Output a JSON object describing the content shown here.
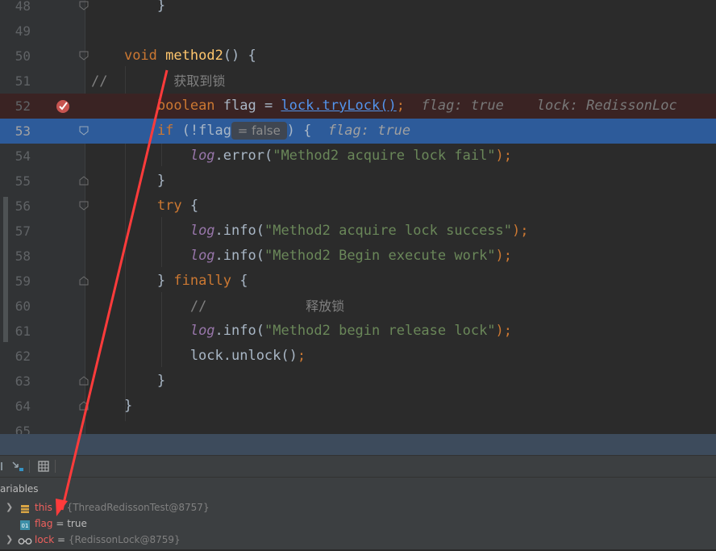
{
  "editor": {
    "lines": [
      {
        "num": "48",
        "segments": [
          {
            "t": "        }",
            "c": ""
          }
        ]
      },
      {
        "num": "49",
        "segments": []
      },
      {
        "num": "50",
        "segments": [
          {
            "t": "    ",
            "c": ""
          },
          {
            "t": "void",
            "c": "kw"
          },
          {
            "t": " ",
            "c": ""
          },
          {
            "t": "method2",
            "c": "fn"
          },
          {
            "t": "() {",
            "c": ""
          }
        ]
      },
      {
        "num": "51",
        "segments": [
          {
            "t": "//",
            "c": "cm"
          },
          {
            "t": "        ",
            "c": ""
          },
          {
            "t": "获取到锁",
            "c": "cm-cn"
          }
        ]
      },
      {
        "num": "52",
        "segments": [
          {
            "t": "        ",
            "c": ""
          },
          {
            "t": "boolean",
            "c": "kw"
          },
          {
            "t": " flag = ",
            "c": ""
          },
          {
            "t": "lock.tryLock()",
            "c": "link"
          },
          {
            "t": ";",
            "c": "kw"
          },
          {
            "t": "  flag: true    lock: RedissonLoc",
            "c": "hint"
          }
        ]
      },
      {
        "num": "53",
        "segments": [
          {
            "t": "        ",
            "c": ""
          },
          {
            "t": "if",
            "c": "kw"
          },
          {
            "t": " (!flag",
            "c": ""
          },
          {
            "t": " = false ",
            "c": "inlay"
          },
          {
            "t": ") {  ",
            "c": ""
          },
          {
            "t": "flag: true",
            "c": "hint2"
          }
        ]
      },
      {
        "num": "54",
        "segments": [
          {
            "t": "            ",
            "c": ""
          },
          {
            "t": "log",
            "c": "log"
          },
          {
            "t": ".error(",
            "c": ""
          },
          {
            "t": "\"Method2 acquire lock fail\"",
            "c": "str"
          },
          {
            "t": ");",
            "c": "kw"
          }
        ]
      },
      {
        "num": "55",
        "segments": [
          {
            "t": "        }",
            "c": ""
          }
        ]
      },
      {
        "num": "56",
        "segments": [
          {
            "t": "        ",
            "c": ""
          },
          {
            "t": "try",
            "c": "kw"
          },
          {
            "t": " {",
            "c": ""
          }
        ]
      },
      {
        "num": "57",
        "segments": [
          {
            "t": "            ",
            "c": ""
          },
          {
            "t": "log",
            "c": "log"
          },
          {
            "t": ".info(",
            "c": ""
          },
          {
            "t": "\"Method2 acquire lock success\"",
            "c": "str"
          },
          {
            "t": ");",
            "c": "kw"
          }
        ]
      },
      {
        "num": "58",
        "segments": [
          {
            "t": "            ",
            "c": ""
          },
          {
            "t": "log",
            "c": "log"
          },
          {
            "t": ".info(",
            "c": ""
          },
          {
            "t": "\"Method2 Begin execute work\"",
            "c": "str"
          },
          {
            "t": ");",
            "c": "kw"
          }
        ]
      },
      {
        "num": "59",
        "segments": [
          {
            "t": "        } ",
            "c": ""
          },
          {
            "t": "finally",
            "c": "kw"
          },
          {
            "t": " {",
            "c": ""
          }
        ]
      },
      {
        "num": "60",
        "segments": [
          {
            "t": "            ",
            "c": ""
          },
          {
            "t": "//",
            "c": "cm"
          },
          {
            "t": "            ",
            "c": ""
          },
          {
            "t": "释放锁",
            "c": "cm-cn"
          }
        ]
      },
      {
        "num": "61",
        "segments": [
          {
            "t": "            ",
            "c": ""
          },
          {
            "t": "log",
            "c": "log"
          },
          {
            "t": ".info(",
            "c": ""
          },
          {
            "t": "\"Method2 begin release lock\"",
            "c": "str"
          },
          {
            "t": ");",
            "c": "kw"
          }
        ]
      },
      {
        "num": "62",
        "segments": [
          {
            "t": "            lock.unlock()",
            "c": ""
          },
          {
            "t": ";",
            "c": "kw"
          }
        ]
      },
      {
        "num": "63",
        "segments": [
          {
            "t": "        }",
            "c": ""
          }
        ]
      },
      {
        "num": "64",
        "segments": [
          {
            "t": "    }",
            "c": ""
          }
        ]
      },
      {
        "num": "65",
        "segments": []
      }
    ],
    "breakpoint_line": "52",
    "current_line": "53"
  },
  "debugger": {
    "variables_label": "ariables",
    "variables": [
      {
        "name": "this",
        "eq": " = ",
        "value": "{ThreadRedissonTest@8757}",
        "kind": "object",
        "expandable": true,
        "icon": "field-icon"
      },
      {
        "name": "flag",
        "eq": " = ",
        "value": "true",
        "kind": "primitive",
        "expandable": false,
        "icon": "primitive-icon"
      },
      {
        "name": "lock",
        "eq": " = ",
        "value": "{RedissonLock@8759}",
        "kind": "object",
        "expandable": true,
        "icon": "watch-glasses-icon"
      }
    ]
  },
  "colors": {
    "background": "#2b2b2b",
    "current_line": "#2d5b9a",
    "breakpoint_line": "#3a2323",
    "keyword": "#cc7832",
    "string": "#6a8759",
    "annotation_arrow": "#ff3b3b"
  }
}
